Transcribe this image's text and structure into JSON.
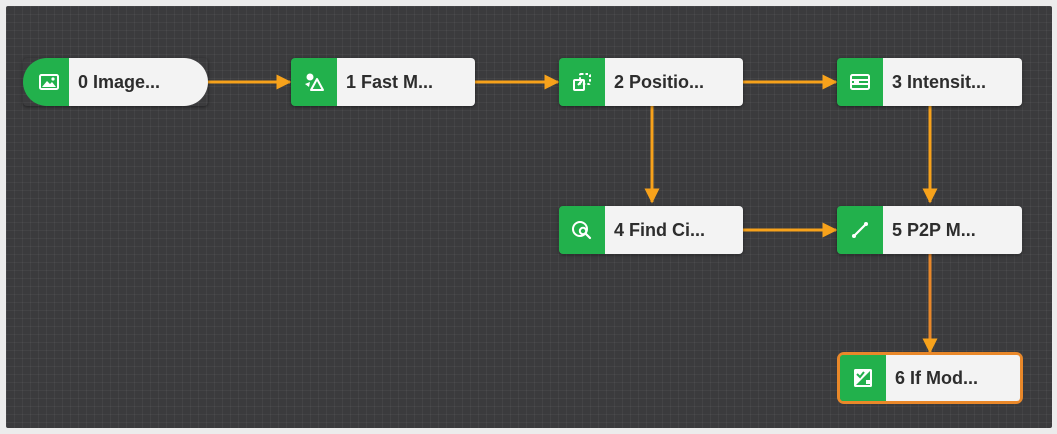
{
  "canvas": {
    "edge_color": "#f7a21b",
    "node_icon_color": "#22b14c",
    "node_label_bg": "#f3f3f3",
    "selected_outline": "#e9882a"
  },
  "nodes": [
    {
      "id": "0",
      "label": "0 Image...",
      "icon": "image-icon"
    },
    {
      "id": "1",
      "label": "1 Fast M...",
      "icon": "fast-match-icon"
    },
    {
      "id": "2",
      "label": "2 Positio...",
      "icon": "position-fix-icon"
    },
    {
      "id": "3",
      "label": "3 Intensit...",
      "icon": "intensity-icon"
    },
    {
      "id": "4",
      "label": "4 Find Ci...",
      "icon": "find-circle-icon"
    },
    {
      "id": "5",
      "label": "5 P2P M...",
      "icon": "p2p-measure-icon"
    },
    {
      "id": "6",
      "label": "6 If Mod...",
      "icon": "if-module-icon",
      "selected": true
    }
  ],
  "edges": [
    {
      "from": "0",
      "to": "1"
    },
    {
      "from": "1",
      "to": "2"
    },
    {
      "from": "2",
      "to": "3"
    },
    {
      "from": "2",
      "to": "4"
    },
    {
      "from": "3",
      "to": "5"
    },
    {
      "from": "4",
      "to": "5"
    },
    {
      "from": "5",
      "to": "6"
    }
  ]
}
